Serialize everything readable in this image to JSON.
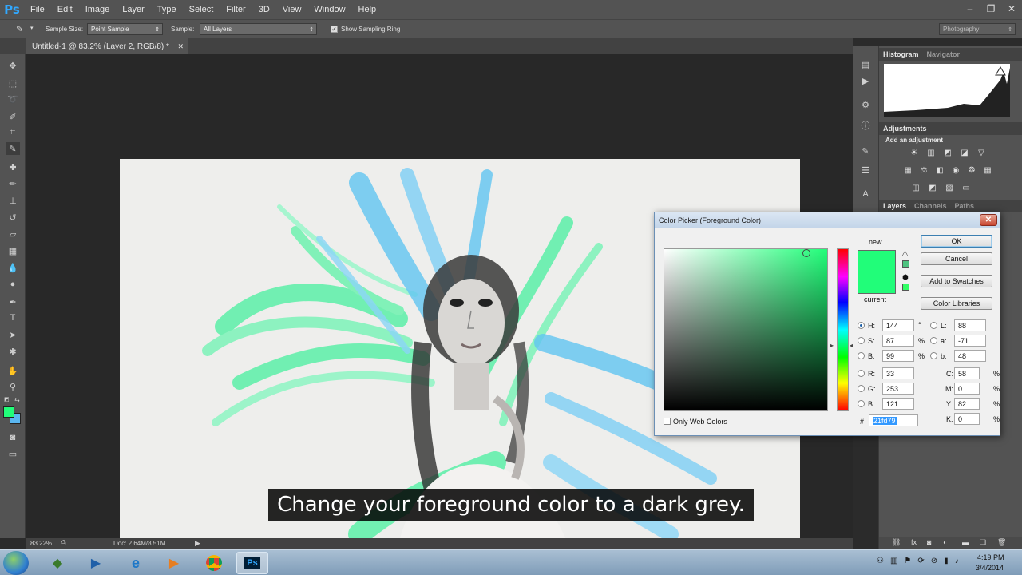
{
  "app": {
    "logo": "Ps",
    "menus": [
      "File",
      "Edit",
      "Image",
      "Layer",
      "Type",
      "Select",
      "Filter",
      "3D",
      "View",
      "Window",
      "Help"
    ]
  },
  "options_bar": {
    "sample_size_label": "Sample Size:",
    "sample_size_value": "Point Sample",
    "sample_label": "Sample:",
    "sample_value": "All Layers",
    "show_sampling_ring_label": "Show Sampling Ring",
    "show_sampling_ring_checked": true,
    "workspace_value": "Photography"
  },
  "document": {
    "tab_title": "Untitled-1 @ 83.2% (Layer 2, RGB/8) *"
  },
  "status": {
    "zoom": "83.22%",
    "doc_size": "Doc: 2.64M/8.51M"
  },
  "panels": {
    "histogram_tab": "Histogram",
    "navigator_tab": "Navigator",
    "adjustments_tab": "Adjustments",
    "add_adjustment": "Add an adjustment",
    "layers_tab": "Layers",
    "channels_tab": "Channels",
    "paths_tab": "Paths"
  },
  "color_picker": {
    "title": "Color Picker (Foreground Color)",
    "new_label": "new",
    "current_label": "current",
    "ok": "OK",
    "cancel": "Cancel",
    "add_to_swatches": "Add to Swatches",
    "color_libraries": "Color Libraries",
    "only_web_colors": "Only Web Colors",
    "new_color": "#21fd79",
    "current_color": "#21fd79",
    "H": "144",
    "S": "87",
    "B": "99",
    "R": "33",
    "G": "253",
    "Bv": "121",
    "L": "88",
    "a": "-71",
    "b": "48",
    "C": "58",
    "M": "0",
    "Y": "82",
    "K": "0",
    "hex": "21fd79",
    "degree_unit": "°",
    "percent_unit": "%"
  },
  "subtitle": "Change your foreground color to a dark grey.",
  "clock": {
    "time": "4:19 PM",
    "date": "3/4/2014"
  }
}
